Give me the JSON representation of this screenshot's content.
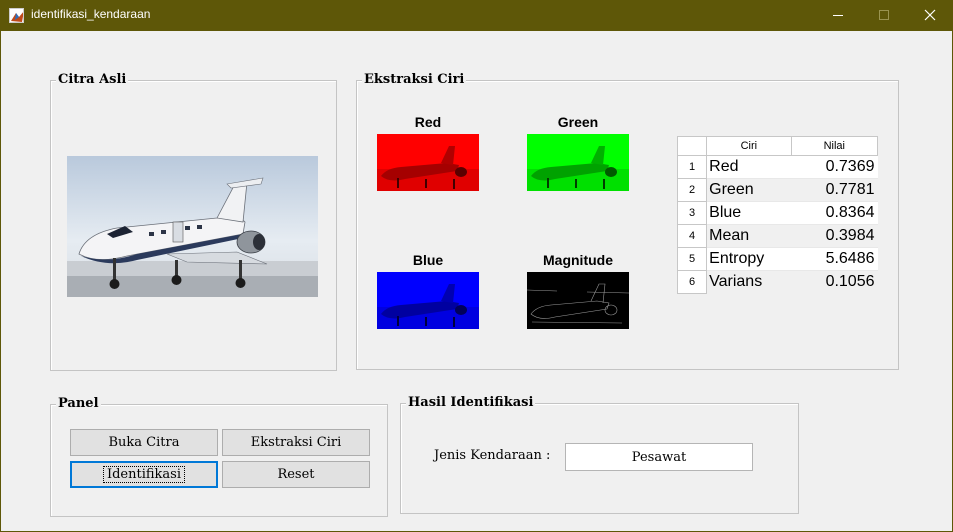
{
  "window": {
    "title": "identifikasi_kendaraan",
    "icon": "matlab-icon",
    "controls": {
      "minimize": "minimize-icon",
      "maximize": "maximize-icon",
      "close": "close-icon"
    }
  },
  "citra_asli": {
    "title": "Citra Asli",
    "image": "airplane-photo"
  },
  "ekstraksi": {
    "title": "Ekstraksi Ciri",
    "channels": [
      {
        "title": "Red",
        "color": "#ff0000"
      },
      {
        "title": "Green",
        "color": "#00ff00"
      },
      {
        "title": "Blue",
        "color": "#0000ff"
      },
      {
        "title": "Magnitude",
        "color": "#000000"
      }
    ],
    "table": {
      "headers": [
        "Ciri",
        "Nilai"
      ],
      "rows": [
        {
          "no": "1",
          "ciri": "Red",
          "nilai": "0.7369"
        },
        {
          "no": "2",
          "ciri": "Green",
          "nilai": "0.7781"
        },
        {
          "no": "3",
          "ciri": "Blue",
          "nilai": "0.8364"
        },
        {
          "no": "4",
          "ciri": "Mean",
          "nilai": "0.3984"
        },
        {
          "no": "5",
          "ciri": "Entropy",
          "nilai": "5.6486"
        },
        {
          "no": "6",
          "ciri": "Varians",
          "nilai": "0.1056"
        }
      ]
    }
  },
  "panel": {
    "title": "Panel",
    "buttons": {
      "buka": "Buka Citra",
      "ekstraksi": "Ekstraksi Ciri",
      "identifikasi": "Identifikasi",
      "reset": "Reset"
    }
  },
  "hasil": {
    "title": "Hasil Identifikasi",
    "label": "Jenis Kendaraan :",
    "value": "Pesawat"
  }
}
